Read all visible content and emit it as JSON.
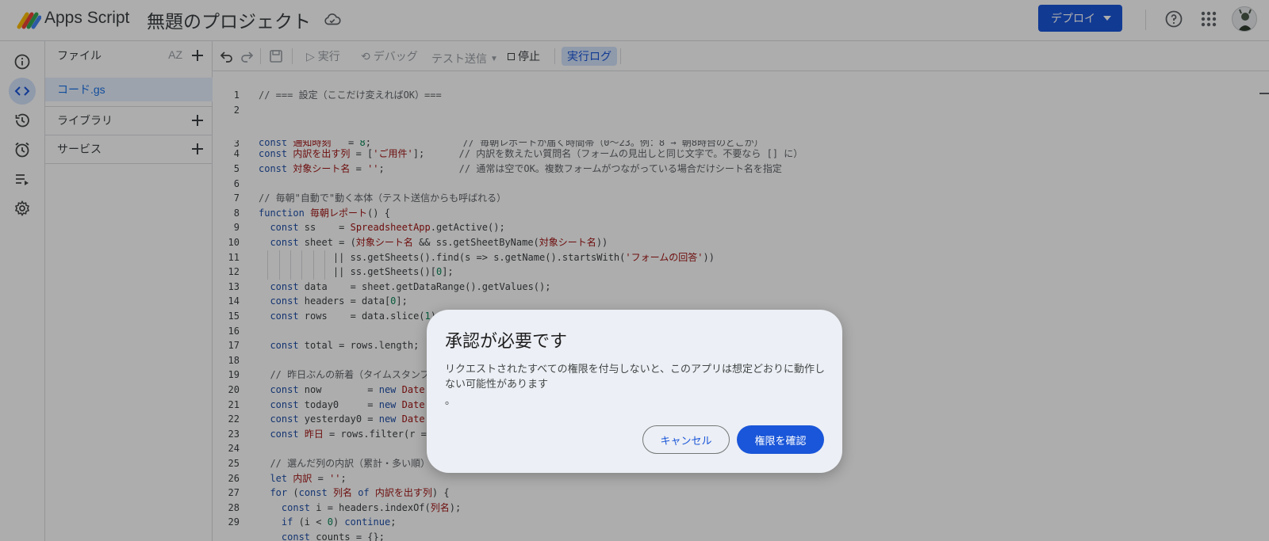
{
  "header": {
    "app_name": "Apps Script",
    "project_title": "無題のプロジェクト",
    "deploy_label": "デプロイ"
  },
  "rail": {
    "items": [
      "info-icon",
      "code-icon",
      "history-icon",
      "trigger-clock-icon",
      "executions-icon",
      "settings-icon"
    ]
  },
  "files_panel": {
    "files_label": "ファイル",
    "sort_label": "AZ",
    "file_name": "コード.gs",
    "libraries_label": "ライブラリ",
    "services_label": "サービス"
  },
  "toolbar": {
    "run_label": "実行",
    "debug_label": "デバッグ",
    "test_send_label": "テスト送信",
    "stop_label": "停止",
    "log_label": "実行ログ"
  },
  "editor": {
    "line_numbers": [
      "1",
      "2",
      "3",
      "4",
      "5",
      "6",
      "7",
      "8",
      "9",
      "10",
      "11",
      "12",
      "13",
      "14",
      "15",
      "16",
      "17",
      "18",
      "19",
      "20",
      "21",
      "22",
      "23",
      "24",
      "25",
      "26",
      "27",
      "28",
      "29"
    ]
  },
  "dialog": {
    "title": "承認が必要です",
    "body": "リクエストされたすべての権限を付与しないと、このアプリは想定どおりに動作しない可能性があります",
    "body_tail": "。",
    "cancel_label": "キャンセル",
    "confirm_label": "権限を確認"
  },
  "colors": {
    "accent": "#1a56d9",
    "active_bg": "#d3e3fd",
    "dialog_bg": "#eceff5"
  }
}
